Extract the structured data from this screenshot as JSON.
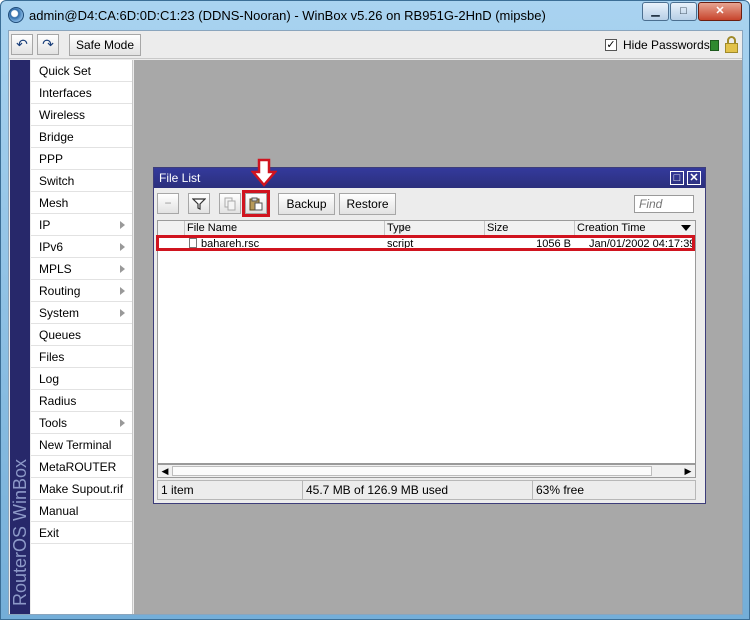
{
  "window": {
    "title": "admin@D4:CA:6D:0D:C1:23 (DDNS-Nooran) - WinBox v5.26 on RB951G-2HnD (mipsbe)",
    "minimize": "▁",
    "maximize": "□",
    "close": "✕"
  },
  "toolbar": {
    "undo_icon": "↶",
    "redo_icon": "↷",
    "safe_mode_label": "Safe Mode",
    "hide_passwords_label": "Hide Passwords",
    "hide_passwords_checked": "✓"
  },
  "brand": {
    "text": "RouterOS WinBox"
  },
  "menu": {
    "items": [
      {
        "label": "Quick Set"
      },
      {
        "label": "Interfaces"
      },
      {
        "label": "Wireless"
      },
      {
        "label": "Bridge"
      },
      {
        "label": "PPP"
      },
      {
        "label": "Switch"
      },
      {
        "label": "Mesh"
      },
      {
        "label": "IP"
      },
      {
        "label": "IPv6"
      },
      {
        "label": "MPLS"
      },
      {
        "label": "Routing"
      },
      {
        "label": "System"
      },
      {
        "label": "Queues"
      },
      {
        "label": "Files"
      },
      {
        "label": "Log"
      },
      {
        "label": "Radius"
      },
      {
        "label": "Tools"
      },
      {
        "label": "New Terminal"
      },
      {
        "label": "MetaROUTER"
      },
      {
        "label": "Make Supout.rif"
      },
      {
        "label": "Manual"
      },
      {
        "label": "Exit"
      }
    ]
  },
  "file_list": {
    "title": "File List",
    "maximize": "□",
    "close": "✕",
    "toolbar": {
      "remove_icon": "−",
      "backup_label": "Backup",
      "restore_label": "Restore",
      "find_placeholder": "Find"
    },
    "columns": {
      "name": "File Name",
      "type": "Type",
      "size": "Size",
      "created": "Creation Time",
      "sort_indicator": "/"
    },
    "rows": [
      {
        "name": "bahareh.rsc",
        "type": "script",
        "size": "1056 B",
        "created": "Jan/01/2002 04:17:39"
      }
    ],
    "scroll_left": "◀",
    "scroll_right": "▶",
    "status": {
      "count": "1 item",
      "used": "45.7 MB of 126.9 MB used",
      "free": "63% free"
    }
  },
  "colors": {
    "brand_strip": "#27286a",
    "window_title": "#343a9c",
    "highlight": "#d0141f"
  }
}
